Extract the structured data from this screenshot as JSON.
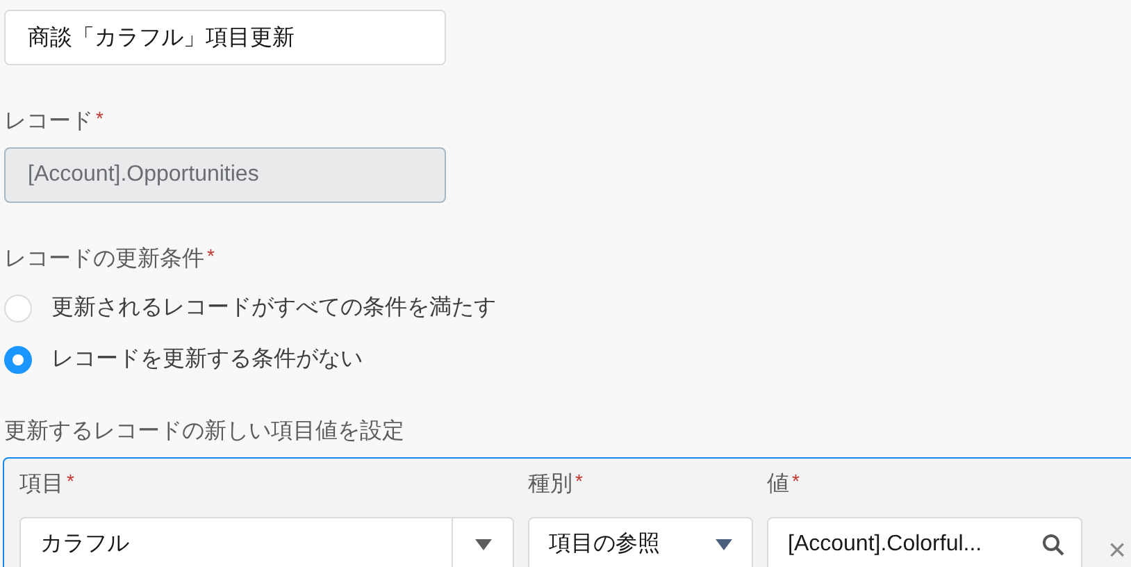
{
  "name_field": {
    "value": "商談「カラフル」項目更新"
  },
  "record": {
    "label": "レコード",
    "mark": "*",
    "value": "[Account].Opportunities",
    "disabled": true
  },
  "condition": {
    "label": "レコードの更新条件",
    "mark": "*",
    "options": [
      {
        "label": "更新されるレコードがすべての条件を満たす",
        "selected": false
      },
      {
        "label": "レコードを更新する条件がない",
        "selected": true
      }
    ]
  },
  "assignments": {
    "title": "更新するレコードの新しい項目値を設定",
    "columns": [
      {
        "label": "項目",
        "mark": "*"
      },
      {
        "label": "種別",
        "mark": "*"
      },
      {
        "label": "値",
        "mark": "*"
      }
    ],
    "row": {
      "field": {
        "kind": "combobox",
        "value": "カラフル"
      },
      "type": {
        "kind": "select",
        "value": "項目の参照"
      },
      "value": {
        "kind": "lookup",
        "value": "[Account].Colorful..."
      },
      "remove": "×"
    }
  }
}
